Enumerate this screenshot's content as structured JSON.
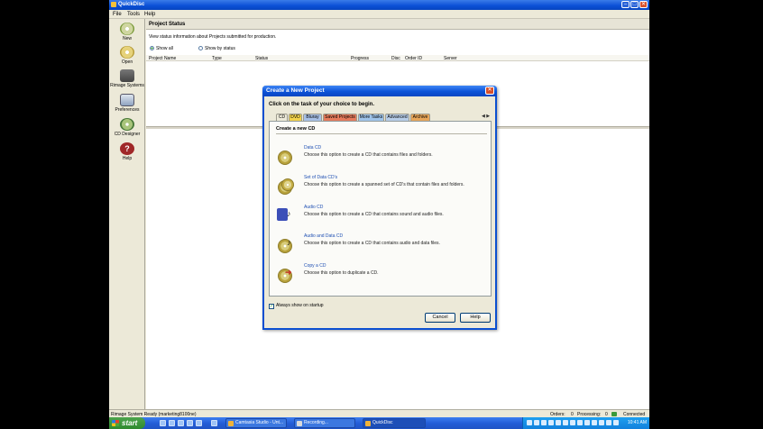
{
  "window": {
    "title": "QuickDisc"
  },
  "menu": [
    "File",
    "Tools",
    "Help"
  ],
  "nav": [
    {
      "label": "New",
      "icon": "new-disc-icon"
    },
    {
      "label": "Open",
      "icon": "open-icon"
    },
    {
      "label": "Rimage Systems",
      "icon": "rimage-systems-icon"
    },
    {
      "label": "Preferences",
      "icon": "preferences-icon"
    },
    {
      "label": "CD Designer",
      "icon": "cd-designer-icon"
    },
    {
      "label": "Help",
      "icon": "help-icon"
    }
  ],
  "project_status": {
    "title": "Project Status",
    "description": "View status information about Projects submitted for production.",
    "radio_show_all": "Show all",
    "radio_show_by_status": "Show by status",
    "columns": [
      "Project Name",
      "Type",
      "Status",
      "Progress",
      "Disc",
      "Order ID",
      "Server"
    ]
  },
  "dialog": {
    "title": "Create a New Project",
    "instruction": "Click on the task of your choice to begin.",
    "tabs": [
      {
        "label": "CD",
        "bg": "#ece9d8"
      },
      {
        "label": "DVD",
        "bg": "#f2d24a"
      },
      {
        "label": "Bluray",
        "bg": "#a7c0e6"
      },
      {
        "label": "Saved Projects",
        "bg": "#e67b5c"
      },
      {
        "label": "More Tasks",
        "bg": "#9fc4ea"
      },
      {
        "label": "Advanced",
        "bg": "#b7cde8"
      },
      {
        "label": "Archive",
        "bg": "#e8a65a"
      }
    ],
    "tab_arrows": "◀ ▶",
    "heading": "Create a new CD",
    "options": [
      {
        "title": "Data CD",
        "desc": "Choose this option to create a CD that contains files and folders.",
        "icon": "data-cd-icon"
      },
      {
        "title": "Set of Data CD's",
        "desc": "Choose this option to create a spanned set of CD's that contain files and folders.",
        "icon": "data-cd-set-icon"
      },
      {
        "title": "Audio CD",
        "desc": "Choose this option to create a CD that contains sound and audio files.",
        "icon": "audio-cd-icon"
      },
      {
        "title": "Audio and Data CD",
        "desc": "Choose this option to create a CD that contains audio and data files.",
        "icon": "audio-data-cd-icon"
      },
      {
        "title": "Copy a CD",
        "desc": "Choose this option to duplicate a CD.",
        "icon": "copy-cd-icon"
      }
    ],
    "always_show": "Always show on startup",
    "cancel": "Cancel",
    "help": "Help"
  },
  "statusbar": {
    "left": "Rimage System Ready (marketing8100ne)",
    "orders": "Orders:",
    "orders_val": "0",
    "processing": "Processing:",
    "processing_val": "0",
    "connected": "Connected"
  },
  "taskbar": {
    "start": "start",
    "tasks": [
      "Camtasia Studio - Unt...",
      "Recording...",
      "QuickDisc"
    ],
    "clock": "10:41 AM"
  }
}
